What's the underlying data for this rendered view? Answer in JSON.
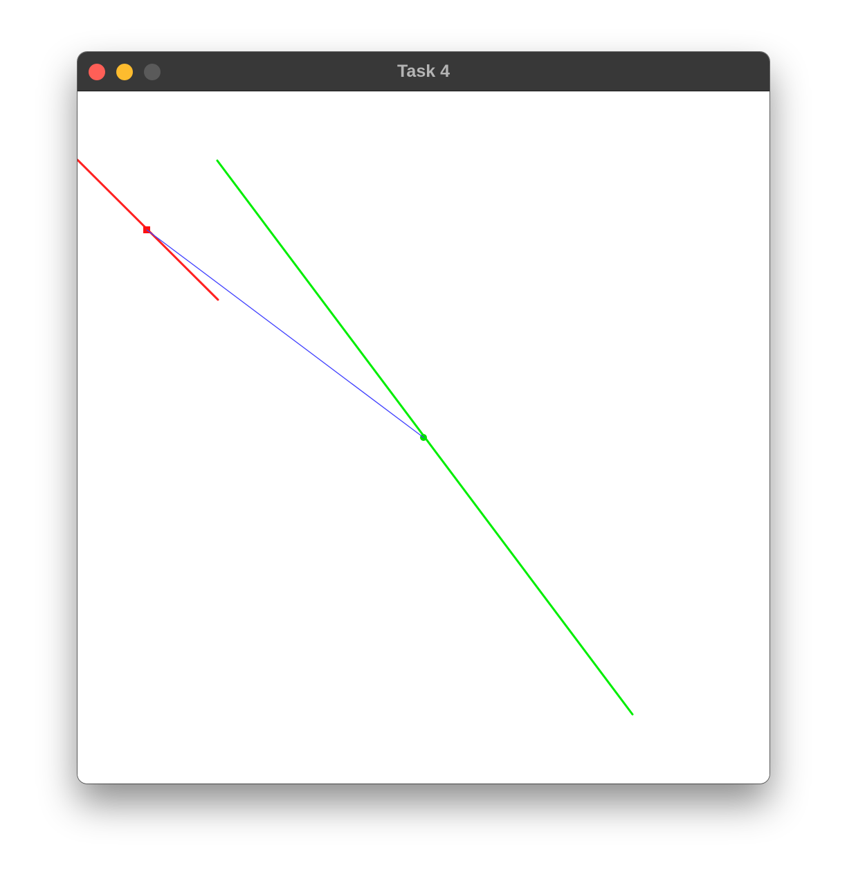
{
  "window": {
    "title": "Task 4",
    "titlebar_color": "#383838",
    "traffic_lights": {
      "close_color": "#ff5f57",
      "minimize_color": "#febc2e",
      "zoom_color": "#5a5a5a"
    }
  },
  "canvas": {
    "background": "#ffffff",
    "red_segment": {
      "color": "#ff2020"
    },
    "green_segment": {
      "color": "#00ee00"
    },
    "blue_segment": {
      "color": "#4040ff"
    }
  }
}
